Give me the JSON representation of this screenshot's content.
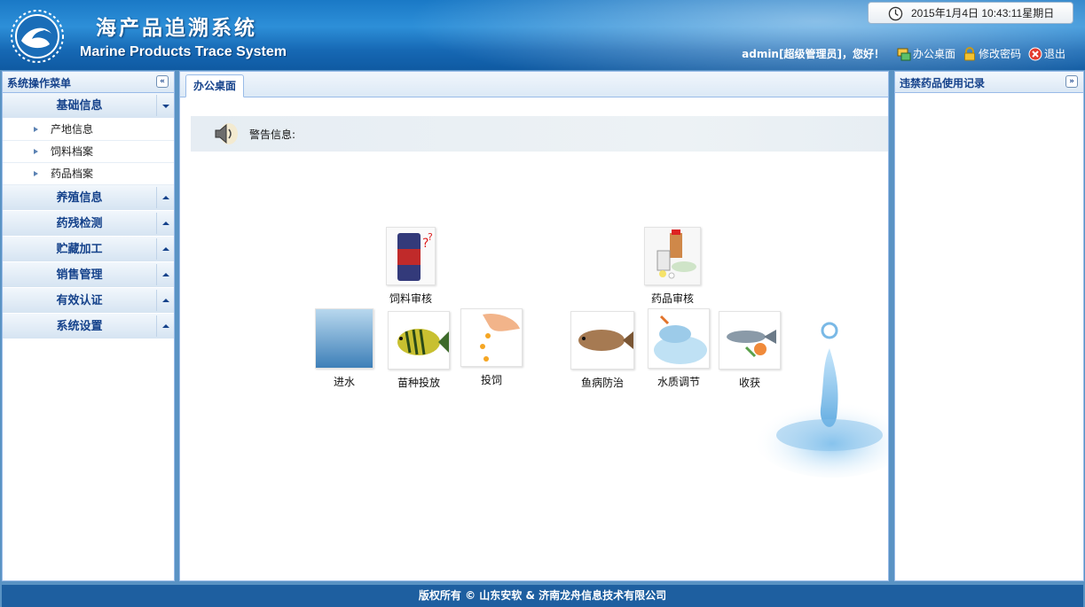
{
  "header": {
    "title_cn": "海产品追溯系统",
    "title_en": "Marine Products Trace System",
    "datetime": "2015年1月4日  10:43:11星期日",
    "greeting": "admin[超级管理员]，您好！",
    "links": {
      "desktop": "办公桌面",
      "change_password": "修改密码",
      "logout": "退出"
    }
  },
  "left_panel": {
    "title": "系统操作菜单",
    "sections": [
      {
        "label": "基础信息",
        "expanded": true,
        "items": [
          "产地信息",
          "饲料档案",
          "药品档案"
        ]
      },
      {
        "label": "养殖信息",
        "expanded": false
      },
      {
        "label": "药残检测",
        "expanded": false
      },
      {
        "label": "贮藏加工",
        "expanded": false
      },
      {
        "label": "销售管理",
        "expanded": false
      },
      {
        "label": "有效认证",
        "expanded": false
      },
      {
        "label": "系统设置",
        "expanded": false
      }
    ]
  },
  "center": {
    "tab_label": "办公桌面",
    "alert_label": "警告信息:",
    "flow": {
      "feed_review": "饲料审核",
      "drug_review": "药品审核",
      "water_in": "进水",
      "fry_release": "苗种投放",
      "feeding": "投饲",
      "disease_control": "鱼病防治",
      "water_quality": "水质调节",
      "harvest": "收获"
    }
  },
  "right_panel": {
    "title": "违禁药品使用记录"
  },
  "footer": {
    "copyright": "版权所有 © 山东安软 & 济南龙舟信息技术有限公司"
  },
  "colors": {
    "header_blue": "#1a79c6",
    "panel_title": "#15428b",
    "footer_blue": "#1e5fa0"
  }
}
